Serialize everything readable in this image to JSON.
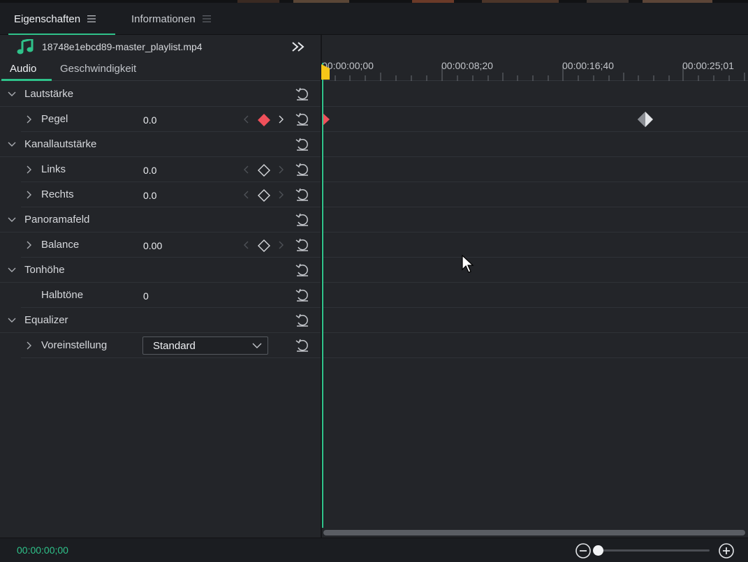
{
  "tabs": [
    {
      "label": "Eigenschaften",
      "active": true
    },
    {
      "label": "Informationen",
      "active": false
    }
  ],
  "file": {
    "name": "18748e1ebcd89-master_playlist.mp4",
    "icon": "music-note-icon"
  },
  "subtabs": [
    {
      "label": "Audio",
      "active": true
    },
    {
      "label": "Geschwindigkeit",
      "active": false
    }
  ],
  "properties": {
    "lautstaerke": {
      "label": "Lautstärke"
    },
    "pegel": {
      "label": "Pegel",
      "value": "0.0"
    },
    "kanallautstaerke": {
      "label": "Kanallautstärke"
    },
    "links": {
      "label": "Links",
      "value": "0.0"
    },
    "rechts": {
      "label": "Rechts",
      "value": "0.0"
    },
    "panoramafeld": {
      "label": "Panoramafeld"
    },
    "balance": {
      "label": "Balance",
      "value": "0.00"
    },
    "tonhoehe": {
      "label": "Tonhöhe"
    },
    "halbtoene": {
      "label": "Halbtöne",
      "value": "0"
    },
    "equalizer": {
      "label": "Equalizer"
    },
    "voreinstellung": {
      "label": "Voreinstellung",
      "value": "Standard"
    }
  },
  "ruler": {
    "labels": [
      "00:00:00;00",
      "00:00:08;20",
      "00:00:16;40",
      "00:00:25;01"
    ]
  },
  "status": {
    "timecode": "00:00:00;00"
  },
  "colors": {
    "accent": "#2fc28a",
    "keyframe_active": "#f0505a",
    "playhead_handle": "#f5c518"
  }
}
